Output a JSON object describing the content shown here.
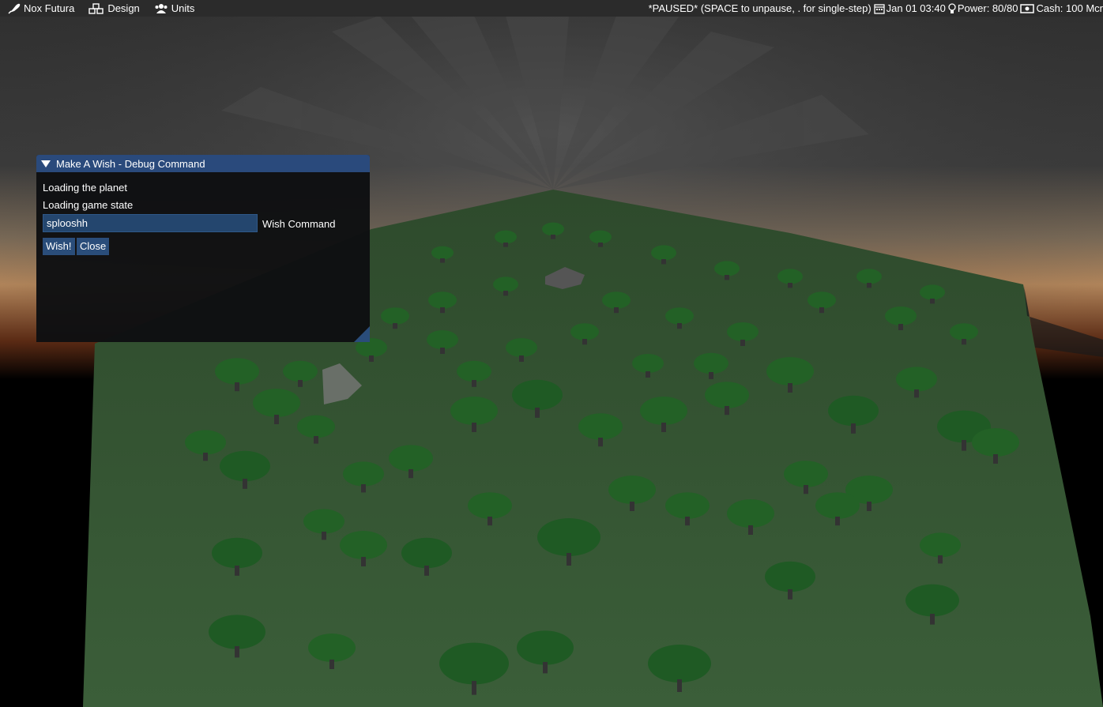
{
  "menubar": {
    "items": [
      {
        "label": "Nox Futura",
        "icon": "rocket-icon"
      },
      {
        "label": "Design",
        "icon": "cubes-icon"
      },
      {
        "label": "Units",
        "icon": "users-icon"
      }
    ],
    "status": {
      "paused": "*PAUSED* (SPACE to unpause, . for single-step)",
      "date": "Jan 01 03:40",
      "power": "Power: 80/80",
      "cash": "Cash: 100 Mcr"
    }
  },
  "wish_window": {
    "title": "Make A Wish - Debug Command",
    "log": [
      "Loading the planet",
      "Loading game state"
    ],
    "input_value": "splooshh",
    "input_label": "Wish Command",
    "wish_button": "Wish!",
    "close_button": "Close"
  }
}
